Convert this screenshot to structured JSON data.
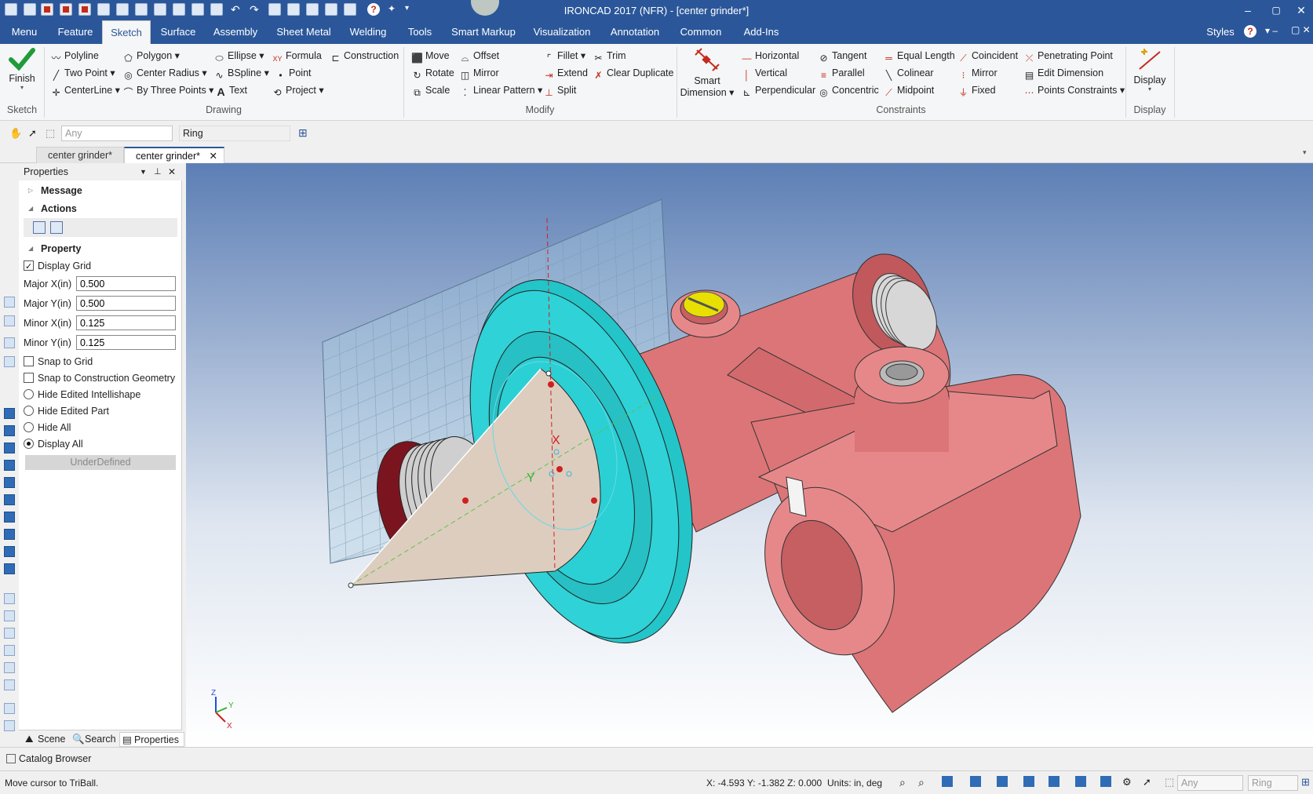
{
  "window": {
    "title": "IRONCAD 2017 (NFR) - [center grinder*]",
    "min": "–",
    "restore": "▢",
    "close": "✕"
  },
  "menu": [
    "Menu",
    "Feature",
    "Sketch",
    "Surface",
    "Assembly",
    "Sheet Metal",
    "Welding",
    "Tools",
    "Smart Markup",
    "Visualization",
    "Annotation",
    "Common",
    "Add-Ins"
  ],
  "menu_right": {
    "styles": "Styles"
  },
  "ribbon": {
    "finish": "Finish",
    "groups": {
      "sketch": "Sketch",
      "drawing": "Drawing",
      "modify": "Modify",
      "constraints": "Constraints",
      "display": "Display"
    },
    "drawing": [
      "Polyline",
      "Polygon",
      "Ellipse",
      "Formula",
      "Construction",
      "Two Point",
      "Center Radius",
      "BSpline",
      "Point",
      "CenterLine",
      "By Three Points",
      "Text",
      "Project"
    ],
    "modify": [
      "Move",
      "Offset",
      "Fillet",
      "Trim",
      "Rotate",
      "Mirror",
      "Extend",
      "Clear Duplicate",
      "Scale",
      "Linear Pattern",
      "Split"
    ],
    "smart_dimension": [
      "Smart",
      "Dimension"
    ],
    "constraints": [
      "Horizontal",
      "Tangent",
      "Equal Length",
      "Coincident",
      "Penetrating Point",
      "Vertical",
      "Parallel",
      "Colinear",
      "Mirror",
      "Edit Dimension",
      "Perpendicular",
      "Concentric",
      "Midpoint",
      "Fixed",
      "Points Constraints"
    ],
    "display": "Display"
  },
  "selection": {
    "filter": "Any",
    "mode": "Ring"
  },
  "doc_tabs": [
    "center grinder*",
    "center grinder*"
  ],
  "properties": {
    "title": "Properties",
    "sections": {
      "message": "Message",
      "actions": "Actions",
      "property": "Property"
    },
    "display_grid": "Display Grid",
    "fields": [
      {
        "label": "Major X(in)",
        "value": "0.500"
      },
      {
        "label": "Major Y(in)",
        "value": "0.500"
      },
      {
        "label": "Minor X(in)",
        "value": "0.125"
      },
      {
        "label": "Minor Y(in)",
        "value": "0.125"
      }
    ],
    "snap_grid": "Snap to Grid",
    "snap_construction": "Snap to Construction Geometry",
    "hide_intellishape": "Hide Edited Intellishape",
    "hide_part": "Hide Edited Part",
    "hide_all": "Hide All",
    "display_all": "Display All",
    "status_btn": "UnderDefined",
    "tabs": [
      "Scene",
      "Search",
      "Properties"
    ]
  },
  "catalog": "Catalog Browser",
  "status": {
    "message": "Move cursor to TriBall.",
    "coords": "X: -4.593 Y: -1.382 Z: 0.000",
    "units": "Units: in, deg",
    "filter": "Any",
    "mode": "Ring"
  },
  "viewport": {
    "axis_x": "X",
    "axis_y": "Y",
    "axis_z": "Z",
    "sketch_x": "X",
    "sketch_y": "Y"
  }
}
